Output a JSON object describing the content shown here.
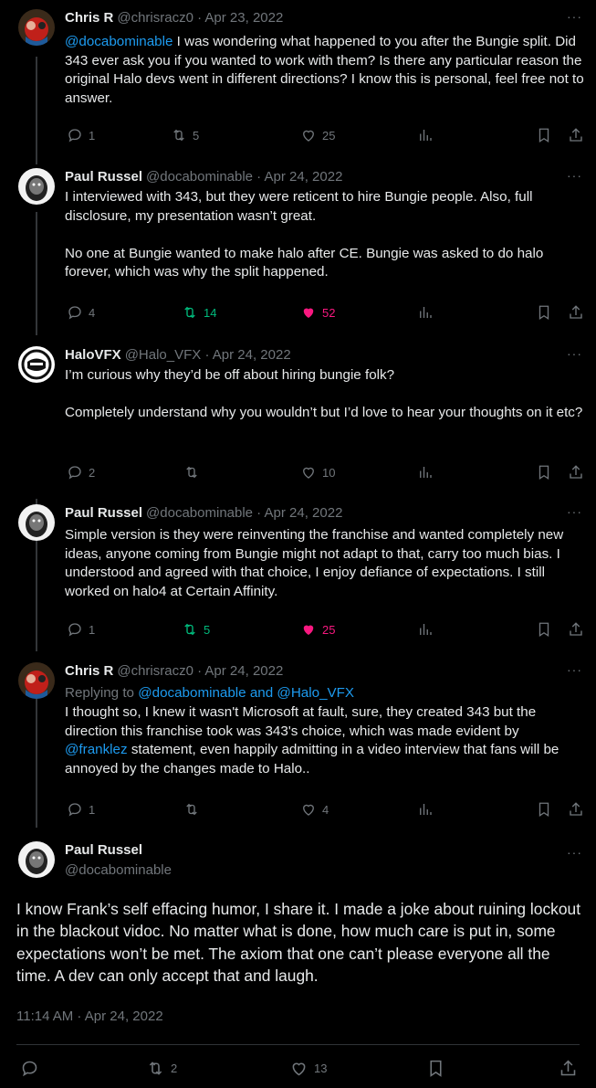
{
  "tweets": [
    {
      "name": "Chris R",
      "handle": "@chrisracz0 · Apr 23, 2022",
      "mention": "@docabominable",
      "text": " I was wondering what happened to you after the Bungie split. Did 343 ever ask you if you wanted to work with them? Is there any particular reason the original Halo devs went in different directions? I know this is personal, feel free not to answer.",
      "replies": "1",
      "retweets": "5",
      "likes": "25"
    },
    {
      "name": "Paul Russel",
      "handle": "@docabominable · Apr 24, 2022",
      "text": "I interviewed with 343, but they were reticent to hire Bungie people. Also, full disclosure, my presentation wasn’t great.\n\nNo one at Bungie wanted to make halo after CE. Bungie was asked to do halo forever, which was why the split happened.",
      "replies": "4",
      "retweets": "14",
      "likes": "52"
    },
    {
      "name": "HaloVFX",
      "handle": "@Halo_VFX · Apr 24, 2022",
      "text": "I’m curious why they’d be off about hiring bungie folk?\n\nCompletely understand why you wouldn’t but I’d love to hear your thoughts on it etc?",
      "replies": "2",
      "retweets": "",
      "likes": "10"
    },
    {
      "name": "Paul Russel",
      "handle": "@docabominable · Apr 24, 2022",
      "text": "Simple version is they were reinventing the franchise and wanted completely new ideas, anyone coming from Bungie might not adapt to that, carry too much bias. I understood and agreed with that choice, I enjoy defiance of expectations. I still worked on halo4 at Certain Affinity.",
      "replies": "1",
      "retweets": "5",
      "likes": "25"
    },
    {
      "name": "Chris R",
      "handle": "@chrisracz0 · Apr 24, 2022",
      "replying_prefix": "Replying to ",
      "replying_to": "@docabominable and @Halo_VFX",
      "text_before": "I thought so, I knew it wasn't Microsoft at fault, sure, they created 343 but the direction this franchise took was 343's choice, which was made evident by ",
      "mention": "@franklez",
      "text_after": " statement, even happily admitting in a video interview that fans will be annoyed by the changes made to Halo..",
      "replies": "1",
      "retweets": "",
      "likes": "4"
    }
  ],
  "main": {
    "name": "Paul Russel",
    "handle": "@docabominable",
    "text": "I know Frank’s self effacing humor, I share it. I made a joke about ruining lockout in the blackout vidoc. No matter what is done, how much care is put in, some expectations won’t be met. The axiom that one can’t please everyone all the time. A dev can only accept that and laugh.",
    "timestamp": "11:14 AM · Apr 24, 2022",
    "retweets": "2",
    "likes": "13"
  },
  "more_glyph": "···",
  "colors": {
    "link": "#1d9bf0",
    "retweeted": "#00ba7c",
    "liked": "#f91880",
    "muted": "#71767b"
  }
}
